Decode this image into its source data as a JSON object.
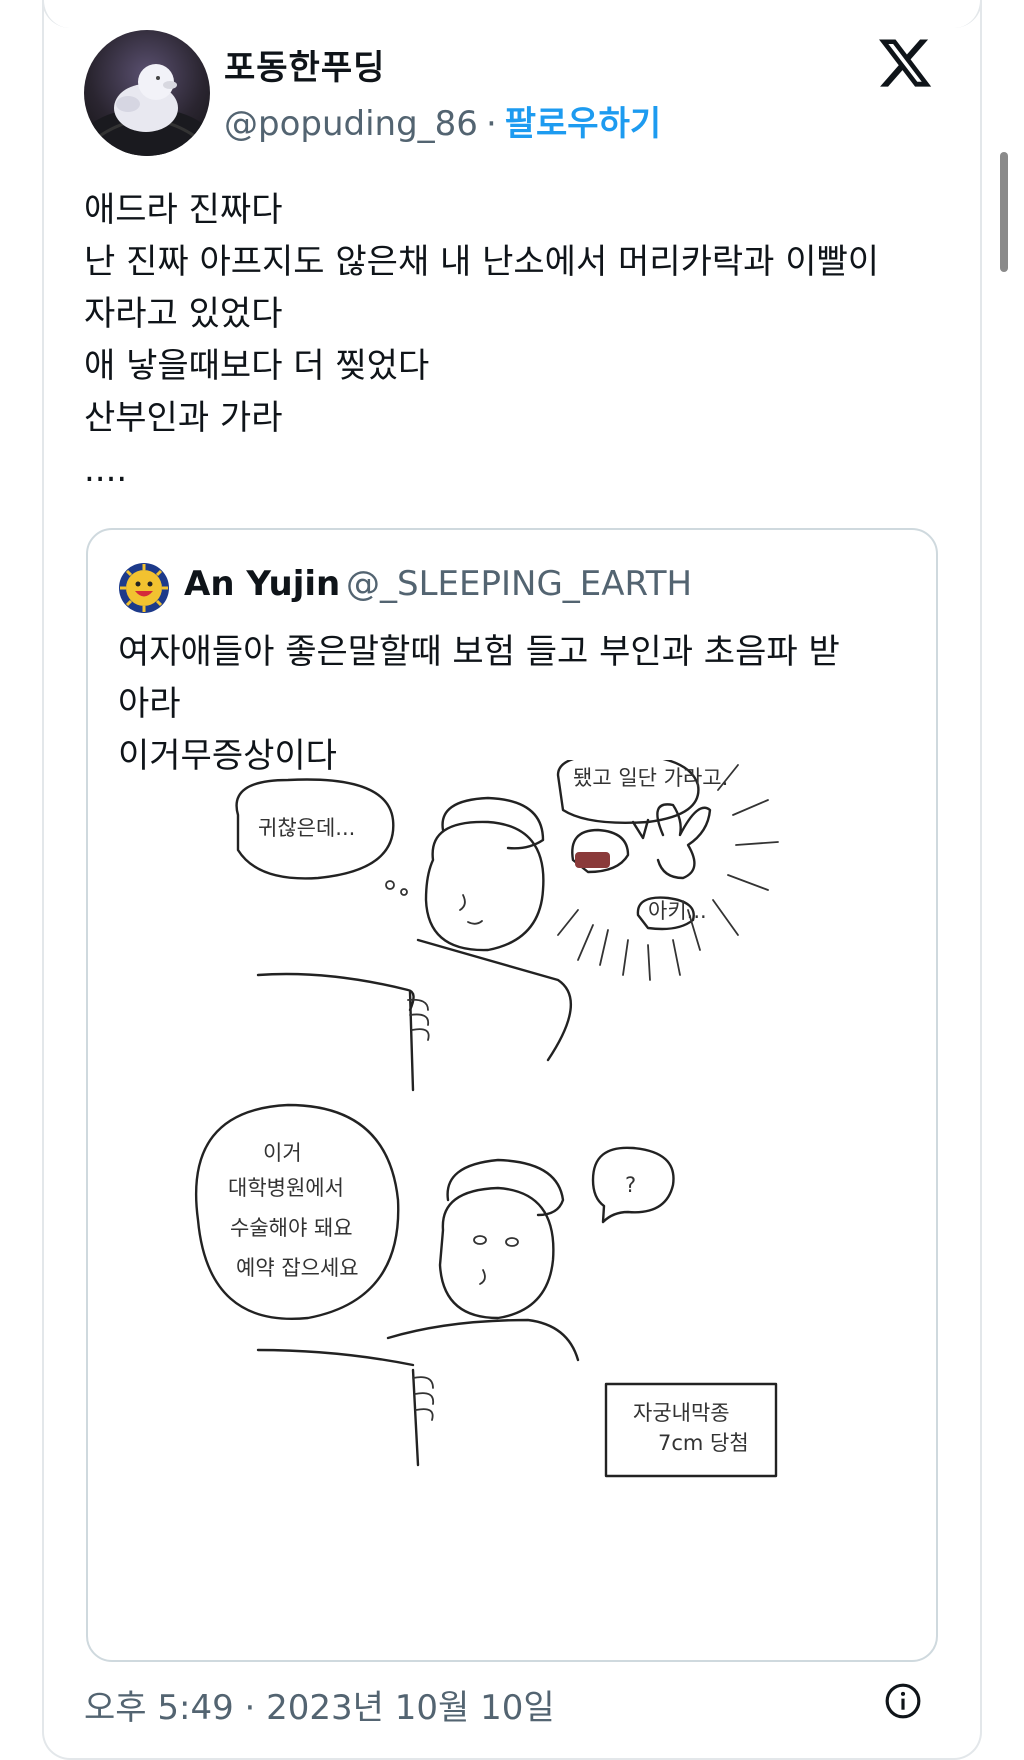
{
  "author": {
    "name": "포동한푸딩",
    "handle": "@popuding_86",
    "separator": "·",
    "follow_label": "팔로우하기"
  },
  "tweet": {
    "text": "애드라 진짜다\n난 진짜 아프지도 않은채 내 난소에서 머리카락과 이빨이\n자라고 있었다\n애 낳을때보다 더 찢었다\n산부인과 가라\n...."
  },
  "quoted_tweet": {
    "name": "An Yujin",
    "handle": "@_SLEEPING_EARTH",
    "text": "여자애들아 좋은말할때 보험 들고 부인과 초음파 받\n아라\n이거무증상이다",
    "comic_text": {
      "bubble_1": "귀찮은데...",
      "bubble_2": "됐고 일단 가라고.",
      "bubble_3": "아키...",
      "bubble_4_line1": "이거",
      "bubble_4_line2": "대학병원에서",
      "bubble_4_line3": "수술해야 돼요",
      "bubble_4_line4": "예약 잡으세요",
      "bubble_5": "?",
      "note_line1": "자궁내막종",
      "note_line2": "7cm 당첨"
    }
  },
  "footer": {
    "timestamp": "오후 5:49 · 2023년 10월 10일"
  },
  "icons": [
    "x-logo-icon",
    "info-icon"
  ],
  "colors": {
    "follow": "#1d9bf0",
    "secondary_text": "#536471",
    "border": "#cfd9de"
  }
}
